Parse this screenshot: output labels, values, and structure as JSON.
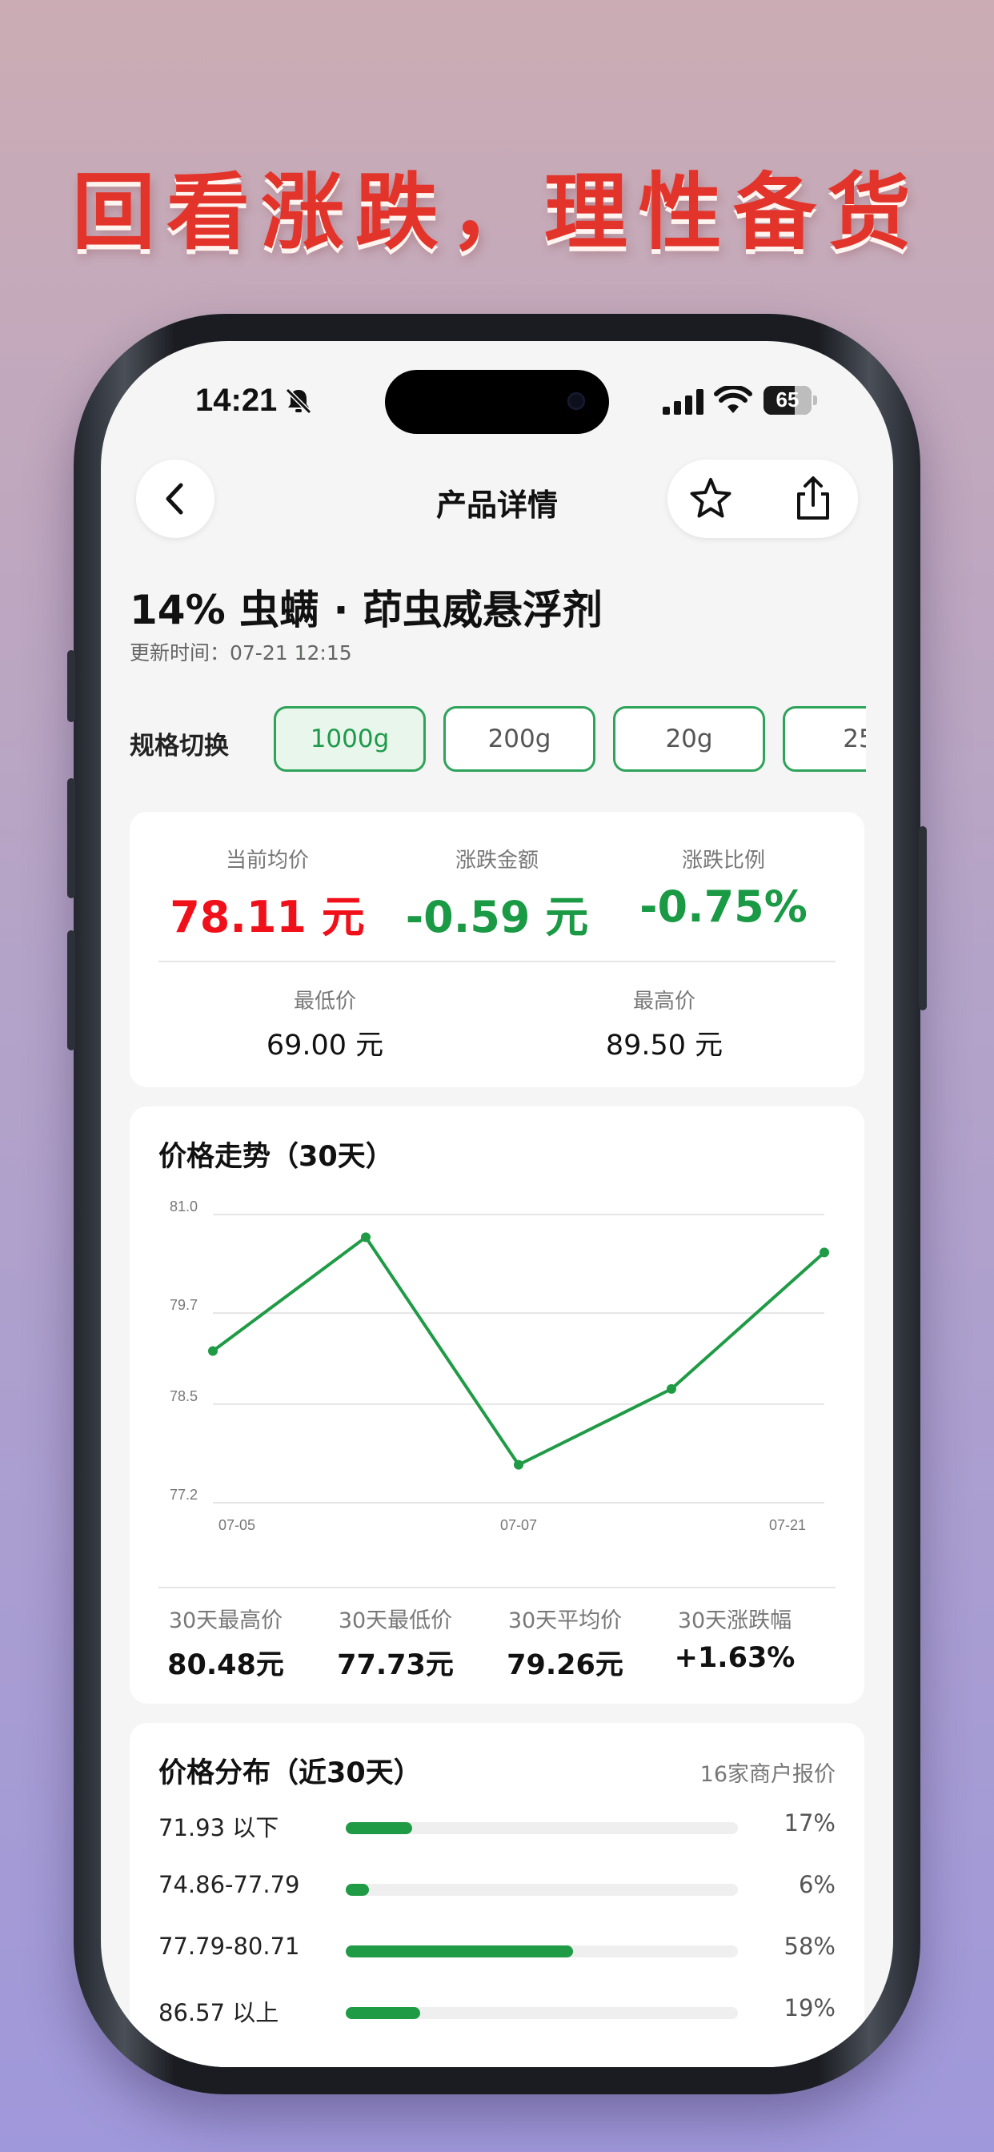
{
  "headline": "回看涨跌，理性备货",
  "status_bar": {
    "time": "14:21",
    "battery": "65",
    "battery_level": 0.65
  },
  "nav": {
    "title": "产品详情"
  },
  "product": {
    "name": "14% 虫螨 · 茚虫威悬浮剂",
    "updated": "更新时间：07-21 12:15"
  },
  "spec": {
    "label": "规格切换",
    "options": [
      "1000g",
      "200g",
      "20g",
      "25"
    ],
    "selected_index": 0
  },
  "price_summary": {
    "current": {
      "label": "当前均价",
      "value": "78.11 元",
      "color": "#f0101a"
    },
    "change_amount": {
      "label": "涨跌金额",
      "value": "-0.59 元",
      "color": "#1a9a45"
    },
    "change_ratio": {
      "label": "涨跌比例",
      "value": "-0.75%",
      "color": "#1a9a45"
    },
    "low": {
      "label": "最低价",
      "value": "69.00 元"
    },
    "high": {
      "label": "最高价",
      "value": "89.50 元"
    }
  },
  "trend": {
    "title": "价格走势（30天）",
    "stats": [
      {
        "label": "30天最高价",
        "value": "80.48元"
      },
      {
        "label": "30天最低价",
        "value": "77.73元"
      },
      {
        "label": "30天平均价",
        "value": "79.26元"
      },
      {
        "label": "30天涨跌幅",
        "value": "+1.63%"
      }
    ]
  },
  "chart_data": {
    "type": "line",
    "ylim": [
      77.2,
      81.0
    ],
    "yticks": [
      "81.0",
      "79.7",
      "78.5",
      "77.2"
    ],
    "xticks": [
      "07-05",
      "07-07",
      "07-21"
    ],
    "line_color": "#1f9b46",
    "grid": true,
    "series": [
      {
        "values": [
          79.2,
          80.7,
          77.7,
          78.7,
          80.5
        ]
      }
    ]
  },
  "distribution": {
    "title": "价格分布（近30天）",
    "subtitle": "16家商户报价",
    "rows": [
      {
        "range": "71.93 以下",
        "pct": "17%",
        "value": 17
      },
      {
        "range": "74.86-77.79",
        "pct": "6%",
        "value": 6
      },
      {
        "range": "77.79-80.71",
        "pct": "58%",
        "value": 58
      },
      {
        "range": "86.57 以上",
        "pct": "19%",
        "value": 19
      }
    ]
  },
  "colors": {
    "accent_green": "#1f9b46",
    "price_red": "#f0101a"
  }
}
